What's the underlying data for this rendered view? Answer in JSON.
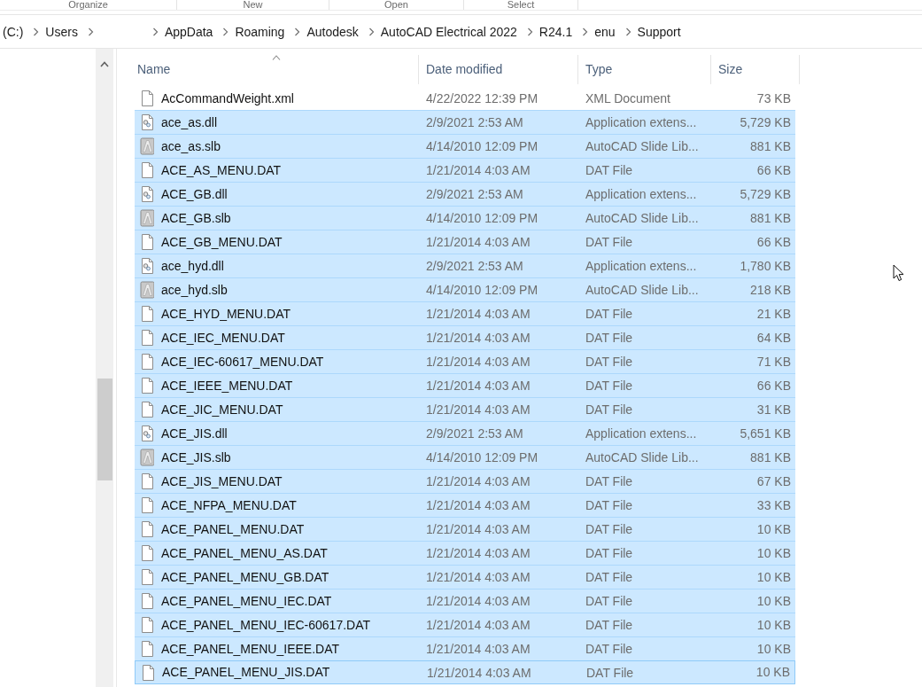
{
  "ribbon": {
    "groups": [
      "Organize",
      "New",
      "Open",
      "Select"
    ]
  },
  "address_bar": {
    "breadcrumbs": [
      {
        "kind": "folder",
        "label": "(C:)"
      },
      {
        "kind": "folder",
        "label": "Users"
      },
      {
        "kind": "blank"
      },
      {
        "kind": "folder",
        "label": "AppData"
      },
      {
        "kind": "folder",
        "label": "Roaming"
      },
      {
        "kind": "folder",
        "label": "Autodesk"
      },
      {
        "kind": "folder",
        "label": "AutoCAD Electrical 2022"
      },
      {
        "kind": "folder",
        "label": "R24.1"
      },
      {
        "kind": "folder",
        "label": "enu"
      },
      {
        "kind": "folder",
        "label": "Support"
      }
    ]
  },
  "file_list": {
    "columns": [
      {
        "label": "Name",
        "sorted": true
      },
      {
        "label": "Date modified",
        "sorted": false
      },
      {
        "label": "Type",
        "sorted": false
      },
      {
        "label": "Size",
        "sorted": false
      }
    ],
    "rows": [
      {
        "kind": "file",
        "name": "AcCommandWeight.xml",
        "date_modified": "4/22/2022 12:39 PM",
        "type": "XML Document",
        "size": "73 KB",
        "selected": false,
        "focused": false
      },
      {
        "kind": "dll",
        "name": "ace_as.dll",
        "date_modified": "2/9/2021 2:53 AM",
        "type": "Application extens...",
        "size": "5,729 KB",
        "selected": true,
        "focused": false
      },
      {
        "kind": "slb",
        "name": "ace_as.slb",
        "date_modified": "4/14/2010 12:09 PM",
        "type": "AutoCAD Slide Lib...",
        "size": "881 KB",
        "selected": true,
        "focused": false
      },
      {
        "kind": "file",
        "name": "ACE_AS_MENU.DAT",
        "date_modified": "1/21/2014 4:03 AM",
        "type": "DAT File",
        "size": "66 KB",
        "selected": true,
        "focused": false
      },
      {
        "kind": "dll",
        "name": "ACE_GB.dll",
        "date_modified": "2/9/2021 2:53 AM",
        "type": "Application extens...",
        "size": "5,729 KB",
        "selected": true,
        "focused": false
      },
      {
        "kind": "slb",
        "name": "ACE_GB.slb",
        "date_modified": "4/14/2010 12:09 PM",
        "type": "AutoCAD Slide Lib...",
        "size": "881 KB",
        "selected": true,
        "focused": false
      },
      {
        "kind": "file",
        "name": "ACE_GB_MENU.DAT",
        "date_modified": "1/21/2014 4:03 AM",
        "type": "DAT File",
        "size": "66 KB",
        "selected": true,
        "focused": false
      },
      {
        "kind": "dll",
        "name": "ace_hyd.dll",
        "date_modified": "2/9/2021 2:53 AM",
        "type": "Application extens...",
        "size": "1,780 KB",
        "selected": true,
        "focused": false
      },
      {
        "kind": "slb",
        "name": "ace_hyd.slb",
        "date_modified": "4/14/2010 12:09 PM",
        "type": "AutoCAD Slide Lib...",
        "size": "218 KB",
        "selected": true,
        "focused": false
      },
      {
        "kind": "file",
        "name": "ACE_HYD_MENU.DAT",
        "date_modified": "1/21/2014 4:03 AM",
        "type": "DAT File",
        "size": "21 KB",
        "selected": true,
        "focused": false
      },
      {
        "kind": "file",
        "name": "ACE_IEC_MENU.DAT",
        "date_modified": "1/21/2014 4:03 AM",
        "type": "DAT File",
        "size": "64 KB",
        "selected": true,
        "focused": false
      },
      {
        "kind": "file",
        "name": "ACE_IEC-60617_MENU.DAT",
        "date_modified": "1/21/2014 4:03 AM",
        "type": "DAT File",
        "size": "71 KB",
        "selected": true,
        "focused": false
      },
      {
        "kind": "file",
        "name": "ACE_IEEE_MENU.DAT",
        "date_modified": "1/21/2014 4:03 AM",
        "type": "DAT File",
        "size": "66 KB",
        "selected": true,
        "focused": false
      },
      {
        "kind": "file",
        "name": "ACE_JIC_MENU.DAT",
        "date_modified": "1/21/2014 4:03 AM",
        "type": "DAT File",
        "size": "31 KB",
        "selected": true,
        "focused": false
      },
      {
        "kind": "dll",
        "name": "ACE_JIS.dll",
        "date_modified": "2/9/2021 2:53 AM",
        "type": "Application extens...",
        "size": "5,651 KB",
        "selected": true,
        "focused": false
      },
      {
        "kind": "slb",
        "name": "ACE_JIS.slb",
        "date_modified": "4/14/2010 12:09 PM",
        "type": "AutoCAD Slide Lib...",
        "size": "881 KB",
        "selected": true,
        "focused": false
      },
      {
        "kind": "file",
        "name": "ACE_JIS_MENU.DAT",
        "date_modified": "1/21/2014 4:03 AM",
        "type": "DAT File",
        "size": "67 KB",
        "selected": true,
        "focused": false
      },
      {
        "kind": "file",
        "name": "ACE_NFPA_MENU.DAT",
        "date_modified": "1/21/2014 4:03 AM",
        "type": "DAT File",
        "size": "33 KB",
        "selected": true,
        "focused": false
      },
      {
        "kind": "file",
        "name": "ACE_PANEL_MENU.DAT",
        "date_modified": "1/21/2014 4:03 AM",
        "type": "DAT File",
        "size": "10 KB",
        "selected": true,
        "focused": false
      },
      {
        "kind": "file",
        "name": "ACE_PANEL_MENU_AS.DAT",
        "date_modified": "1/21/2014 4:03 AM",
        "type": "DAT File",
        "size": "10 KB",
        "selected": true,
        "focused": false
      },
      {
        "kind": "file",
        "name": "ACE_PANEL_MENU_GB.DAT",
        "date_modified": "1/21/2014 4:03 AM",
        "type": "DAT File",
        "size": "10 KB",
        "selected": true,
        "focused": false
      },
      {
        "kind": "file",
        "name": "ACE_PANEL_MENU_IEC.DAT",
        "date_modified": "1/21/2014 4:03 AM",
        "type": "DAT File",
        "size": "10 KB",
        "selected": true,
        "focused": false
      },
      {
        "kind": "file",
        "name": "ACE_PANEL_MENU_IEC-60617.DAT",
        "date_modified": "1/21/2014 4:03 AM",
        "type": "DAT File",
        "size": "10 KB",
        "selected": true,
        "focused": false
      },
      {
        "kind": "file",
        "name": "ACE_PANEL_MENU_IEEE.DAT",
        "date_modified": "1/21/2014 4:03 AM",
        "type": "DAT File",
        "size": "10 KB",
        "selected": true,
        "focused": false
      },
      {
        "kind": "file",
        "name": "ACE_PANEL_MENU_JIS.DAT",
        "date_modified": "1/21/2014 4:03 AM",
        "type": "DAT File",
        "size": "10 KB",
        "selected": true,
        "focused": true
      }
    ]
  }
}
